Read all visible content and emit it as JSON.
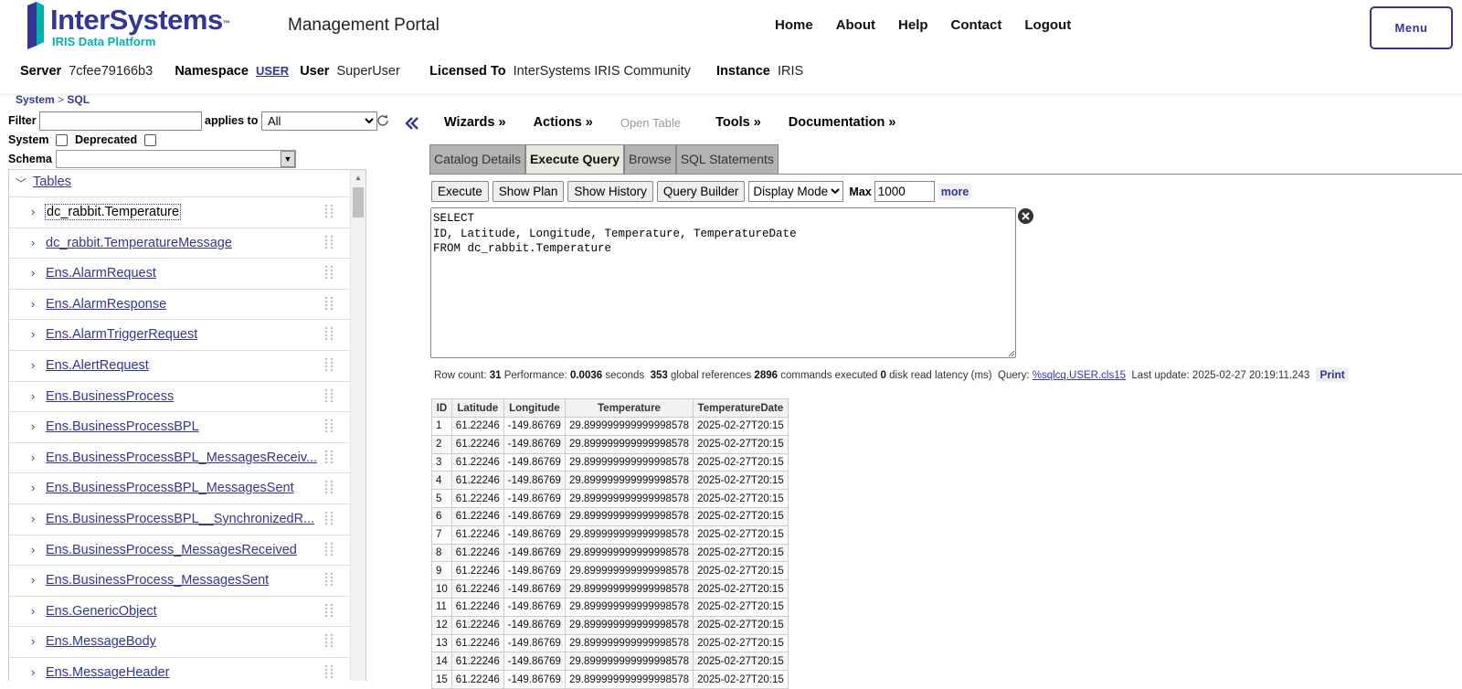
{
  "header": {
    "logo_brand": "InterSystems",
    "logo_tm": "™",
    "logo_sub": "IRIS Data Platform",
    "portal_title": "Management Portal",
    "nav": [
      "Home",
      "About",
      "Help",
      "Contact",
      "Logout"
    ],
    "menu_label": "Menu"
  },
  "info": {
    "server_label": "Server",
    "server": "7cfee79166b3",
    "namespace_label": "Namespace",
    "namespace": "USER",
    "user_label": "User",
    "user": "SuperUser",
    "licensed_label": "Licensed To",
    "licensed": "InterSystems IRIS Community",
    "instance_label": "Instance",
    "instance": "IRIS"
  },
  "breadcrumb": {
    "system": "System",
    "sep": ">",
    "sql": "SQL"
  },
  "filters": {
    "filter_label": "Filter",
    "filter_value": "",
    "applies_label": "applies to",
    "applies_value": "All",
    "system_label": "System",
    "deprecated_label": "Deprecated",
    "schema_label": "Schema"
  },
  "tree": {
    "section": "Tables",
    "items": [
      "dc_rabbit.Temperature",
      "dc_rabbit.TemperatureMessage",
      "Ens.AlarmRequest",
      "Ens.AlarmResponse",
      "Ens.AlarmTriggerRequest",
      "Ens.AlertRequest",
      "Ens.BusinessProcess",
      "Ens.BusinessProcessBPL",
      "Ens.BusinessProcessBPL_MessagesReceiv...",
      "Ens.BusinessProcessBPL_MessagesSent",
      "Ens.BusinessProcessBPL__SynchronizedR...",
      "Ens.BusinessProcess_MessagesReceived",
      "Ens.BusinessProcess_MessagesSent",
      "Ens.GenericObject",
      "Ens.MessageBody",
      "Ens.MessageHeader"
    ]
  },
  "menubar": {
    "wizards": "Wizards »",
    "actions": "Actions »",
    "open_table": "Open Table",
    "tools": "Tools »",
    "documentation": "Documentation »"
  },
  "tabs": [
    "Catalog Details",
    "Execute Query",
    "Browse",
    "SQL Statements"
  ],
  "query_toolbar": {
    "execute": "Execute",
    "show_plan": "Show Plan",
    "show_history": "Show History",
    "query_builder": "Query Builder",
    "display_mode": "Display Mode",
    "max_label": "Max",
    "max_value": "1000",
    "more": "more"
  },
  "query_text": "SELECT\nID, Latitude, Longitude, Temperature, TemperatureDate\nFROM dc_rabbit.Temperature",
  "stats": {
    "row_count_label": "Row count:",
    "row_count": "31",
    "performance_label": "Performance:",
    "performance": "0.0036",
    "seconds": "seconds",
    "global_refs": "353",
    "global_refs_label": "global references",
    "commands": "2896",
    "commands_label": "commands executed",
    "disk": "0",
    "disk_label": "disk read latency (ms)",
    "query_label": "Query:",
    "query_link": "%sqlcq.USER.cls15",
    "update_label": "Last update:",
    "update": "2025-02-27 20:19:11.243",
    "print": "Print"
  },
  "results": {
    "columns": [
      "ID",
      "Latitude",
      "Longitude",
      "Temperature",
      "TemperatureDate"
    ],
    "rows": [
      [
        "1",
        "61.22246",
        "-149.86769",
        "29.899999999999998578",
        "2025-02-27T20:15"
      ],
      [
        "2",
        "61.22246",
        "-149.86769",
        "29.899999999999998578",
        "2025-02-27T20:15"
      ],
      [
        "3",
        "61.22246",
        "-149.86769",
        "29.899999999999998578",
        "2025-02-27T20:15"
      ],
      [
        "4",
        "61.22246",
        "-149.86769",
        "29.899999999999998578",
        "2025-02-27T20:15"
      ],
      [
        "5",
        "61.22246",
        "-149.86769",
        "29.899999999999998578",
        "2025-02-27T20:15"
      ],
      [
        "6",
        "61.22246",
        "-149.86769",
        "29.899999999999998578",
        "2025-02-27T20:15"
      ],
      [
        "7",
        "61.22246",
        "-149.86769",
        "29.899999999999998578",
        "2025-02-27T20:15"
      ],
      [
        "8",
        "61.22246",
        "-149.86769",
        "29.899999999999998578",
        "2025-02-27T20:15"
      ],
      [
        "9",
        "61.22246",
        "-149.86769",
        "29.899999999999998578",
        "2025-02-27T20:15"
      ],
      [
        "10",
        "61.22246",
        "-149.86769",
        "29.899999999999998578",
        "2025-02-27T20:15"
      ],
      [
        "11",
        "61.22246",
        "-149.86769",
        "29.899999999999998578",
        "2025-02-27T20:15"
      ],
      [
        "12",
        "61.22246",
        "-149.86769",
        "29.899999999999998578",
        "2025-02-27T20:15"
      ],
      [
        "13",
        "61.22246",
        "-149.86769",
        "29.899999999999998578",
        "2025-02-27T20:15"
      ],
      [
        "14",
        "61.22246",
        "-149.86769",
        "29.899999999999998578",
        "2025-02-27T20:15"
      ],
      [
        "15",
        "61.22246",
        "-149.86769",
        "29.899999999999998578",
        "2025-02-27T20:15"
      ]
    ]
  },
  "colors": {
    "brand": "#333695",
    "teal": "#00b2a9"
  },
  "icons": {
    "refresh": "refresh-icon",
    "collapse": "double-chevron-left-icon",
    "clear": "clear-circle-icon",
    "grip": "drag-handle-icon",
    "expand": "chevron-right-icon"
  }
}
